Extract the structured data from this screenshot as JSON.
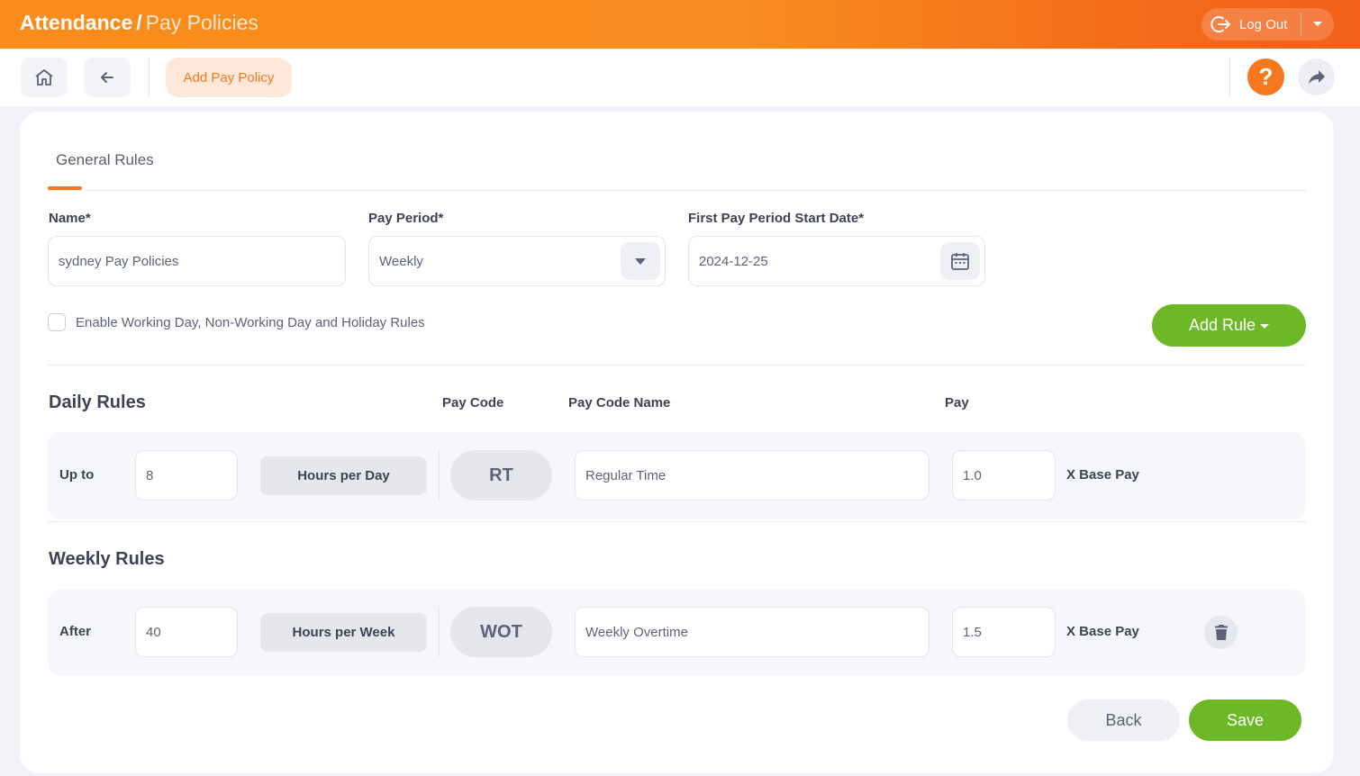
{
  "header": {
    "title_main": "Attendance",
    "title_separator": "/",
    "title_sub": "Pay Policies",
    "logout_label": "Log Out",
    "icons": {
      "logout": "logout-icon",
      "caret": "chevron-down-icon"
    }
  },
  "toolbar": {
    "home_icon": "home-icon",
    "back_icon": "arrow-left-icon",
    "add_pay_policy_label": "Add Pay Policy",
    "help_label": "?",
    "share_icon": "share-icon"
  },
  "tabs": [
    {
      "label": "General Rules",
      "active": true
    }
  ],
  "form": {
    "name": {
      "label": "Name*",
      "value": "sydney Pay Policies"
    },
    "pay_period": {
      "label": "Pay Period*",
      "value": "Weekly"
    },
    "start_date": {
      "label": "First Pay Period Start Date*",
      "value": "2024-12-25",
      "icon": "calendar-icon"
    },
    "enable_rules": {
      "label": "Enable Working Day, Non-Working Day and Holiday Rules",
      "checked": false
    },
    "add_rule_label": "Add Rule"
  },
  "daily_rules": {
    "title": "Daily Rules",
    "columns": {
      "pay_code": "Pay Code",
      "pay_code_name": "Pay Code Name",
      "pay": "Pay"
    },
    "rows": [
      {
        "lead": "Up to",
        "hours": "8",
        "unit": "Hours per Day",
        "code": "RT",
        "code_name": "Regular Time",
        "multiplier": "1.0",
        "suffix": "X Base Pay"
      }
    ]
  },
  "weekly_rules": {
    "title": "Weekly Rules",
    "rows": [
      {
        "lead": "After",
        "hours": "40",
        "unit": "Hours per Week",
        "code": "WOT",
        "code_name": "Weekly Overtime",
        "multiplier": "1.5",
        "suffix": "X Base Pay",
        "delete_icon": "trash-icon"
      }
    ]
  },
  "footer": {
    "back_label": "Back",
    "save_label": "Save"
  },
  "colors": {
    "accent": "#f5781f",
    "success": "#6cb827"
  }
}
